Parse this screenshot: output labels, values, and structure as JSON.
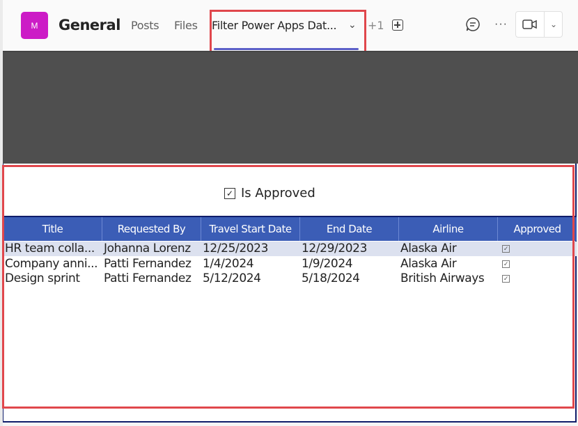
{
  "header": {
    "avatar_initial": "M",
    "avatar_color": "#cc1cc6",
    "channel_title": "General",
    "tabs": [
      {
        "label": "Posts"
      },
      {
        "label": "Files"
      },
      {
        "label": "Filter Power Apps Dat...",
        "active": true
      }
    ],
    "more_tabs_label": "+1",
    "add_tab_icon": "plus-square-icon",
    "chat_icon": "chat-bubble-icon",
    "more_icon_label": "···",
    "meet_icon": "video-camera-icon",
    "accent_color": "#5b5fc7",
    "highlight_color": "#e0474c"
  },
  "filter": {
    "checkbox_checked": true,
    "checkbox_glyph": "✓",
    "label": "Is Approved"
  },
  "table": {
    "header_color": "#3b5db6",
    "columns": [
      "Title",
      "Requested By",
      "Travel Start Date",
      "End Date",
      "Airline",
      "Approved"
    ],
    "rows": [
      {
        "title": "HR team colla...",
        "requested_by": "Johanna Lorenz",
        "start": "12/25/2023",
        "end": "12/29/2023",
        "airline": "Alaska Air",
        "approved": "✓",
        "selected": true
      },
      {
        "title": "Company anni...",
        "requested_by": "Patti Fernandez",
        "start": "1/4/2024",
        "end": "1/9/2024",
        "airline": "Alaska Air",
        "approved": "✓"
      },
      {
        "title": "Design sprint",
        "requested_by": "Patti Fernandez",
        "start": "5/12/2024",
        "end": "5/18/2024",
        "airline": "British Airways",
        "approved": "✓"
      }
    ]
  }
}
